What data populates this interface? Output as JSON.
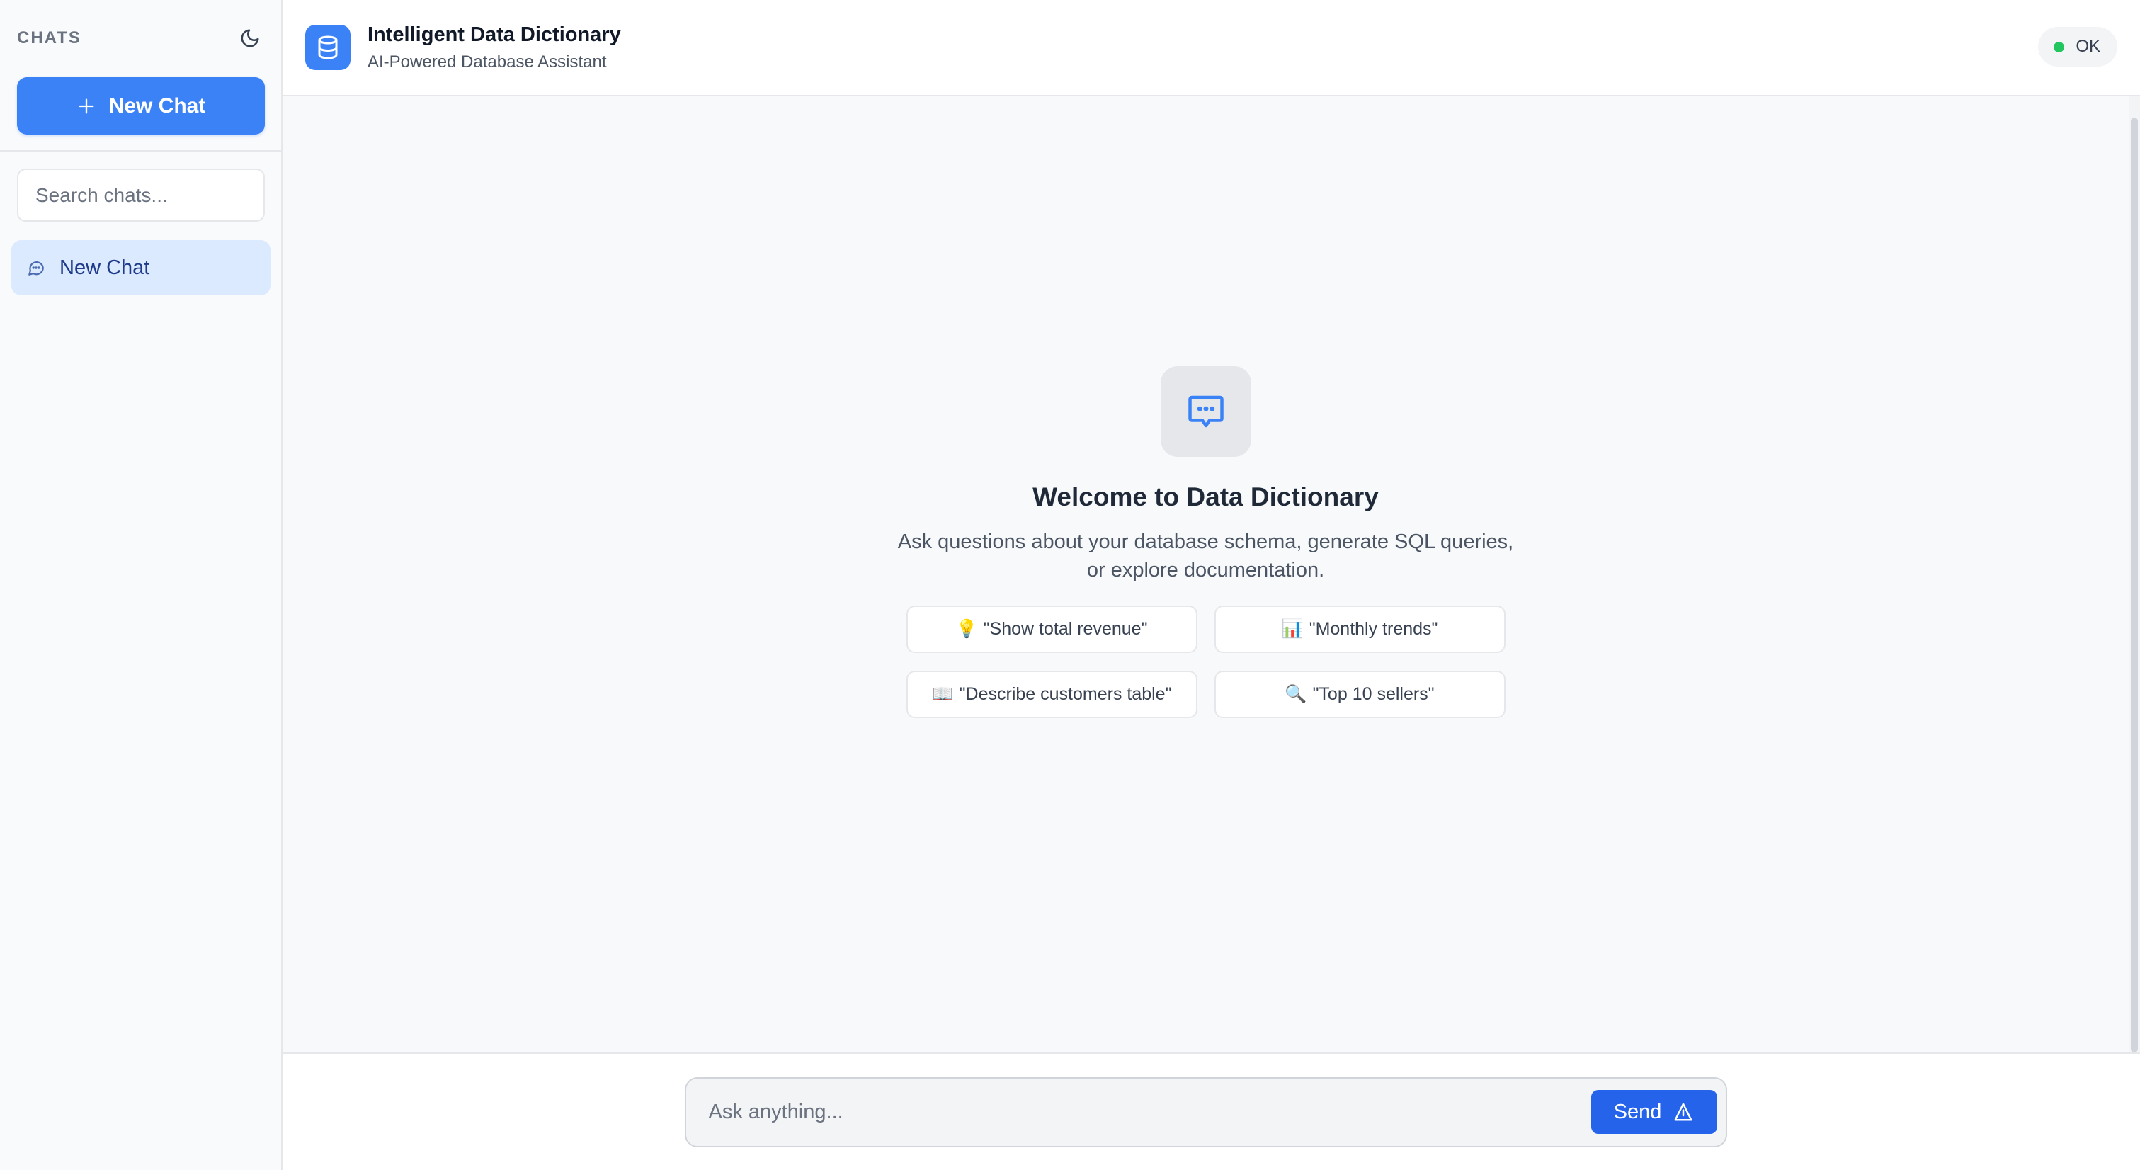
{
  "sidebar": {
    "title": "CHATS",
    "theme_toggle_icon": "moon-icon",
    "new_chat_label": "New Chat",
    "search_placeholder": "Search chats...",
    "items": [
      {
        "label": "New Chat",
        "icon": "chat-bubble-icon",
        "active": true
      }
    ]
  },
  "header": {
    "title": "Intelligent Data Dictionary",
    "subtitle": "AI-Powered Database Assistant",
    "status": "OK",
    "status_color": "#22c55e"
  },
  "welcome": {
    "title": "Welcome to Data Dictionary",
    "description_line1": "Ask questions about your database schema, generate SQL queries,",
    "description_line2": "or explore documentation.",
    "suggestions": [
      {
        "emoji": "💡",
        "text": "\"Show total revenue\""
      },
      {
        "emoji": "📊",
        "text": "\"Monthly trends\""
      },
      {
        "emoji": "📖",
        "text": "\"Describe customers table\""
      },
      {
        "emoji": "🔍",
        "text": "\"Top 10 sellers\""
      }
    ]
  },
  "composer": {
    "placeholder": "Ask anything...",
    "send_label": "Send"
  },
  "colors": {
    "accent": "#3b82f6",
    "send": "#2563eb",
    "active_item_bg": "#dbeafe"
  }
}
